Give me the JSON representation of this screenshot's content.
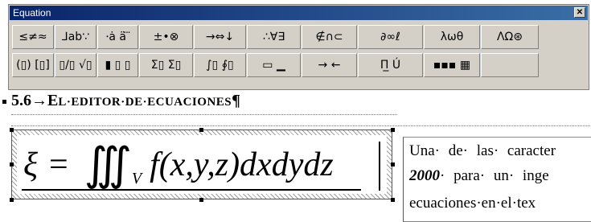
{
  "window": {
    "title": "Equation",
    "close_glyph": "✕"
  },
  "palette": {
    "row1": [
      {
        "icon": "relational-symbols-icon",
        "label": "≤≠≈"
      },
      {
        "icon": "spaces-ellipses-icon",
        "label": "⅃ab∵"
      },
      {
        "icon": "embellishments-icon",
        "label": "⸱ȧ ä ⃛"
      },
      {
        "icon": "operator-symbols-icon",
        "label": "±•⊗"
      },
      {
        "icon": "arrow-symbols-icon",
        "label": "→⇔↓"
      },
      {
        "icon": "logical-symbols-icon",
        "label": "∴∀∃"
      },
      {
        "icon": "set-theory-icon",
        "label": "∉∩⊂"
      },
      {
        "icon": "misc-symbols-icon",
        "label": "∂∞ℓ"
      },
      {
        "icon": "greek-lowercase-icon",
        "label": "λωθ"
      },
      {
        "icon": "greek-uppercase-icon",
        "label": "ΛΩ⊛"
      }
    ],
    "row2": [
      {
        "icon": "fence-templates-icon",
        "label": "(▯) [▯]"
      },
      {
        "icon": "fraction-radical-icon",
        "label": "▯/▯ √▯"
      },
      {
        "icon": "subscript-superscript-icon",
        "label": "▮ ▯ ▯"
      },
      {
        "icon": "summation-templates-icon",
        "label": "Σ▯ Σ▯"
      },
      {
        "icon": "integral-templates-icon",
        "label": "∫▯ ∮▯"
      },
      {
        "icon": "underbar-overbar-icon",
        "label": "▭ ▁"
      },
      {
        "icon": "labeled-arrow-icon",
        "label": "→ ←"
      },
      {
        "icon": "products-set-theory-icon",
        "label": "Π̲ Ú"
      },
      {
        "icon": "matrix-templates-icon",
        "label": "▪▪▪ ▦"
      },
      {
        "icon": "empty-slot",
        "label": ""
      }
    ]
  },
  "document": {
    "heading": {
      "number": "5.6→",
      "big_e": "E",
      "rest": "L·EDITOR·DE·ECUACIONES",
      "pilcrow": "¶"
    },
    "equation": {
      "xi": "ξ",
      "equals": "=",
      "integrals": "∭",
      "subscript": "V",
      "expression": "f(x,y,z)dxdydz"
    },
    "body_lines": [
      {
        "text": "Una· de· las· caracter"
      },
      {
        "emph": "2000",
        "text": "· para· un· inge"
      },
      {
        "text": "ecuaciones·en·el·tex"
      }
    ]
  }
}
